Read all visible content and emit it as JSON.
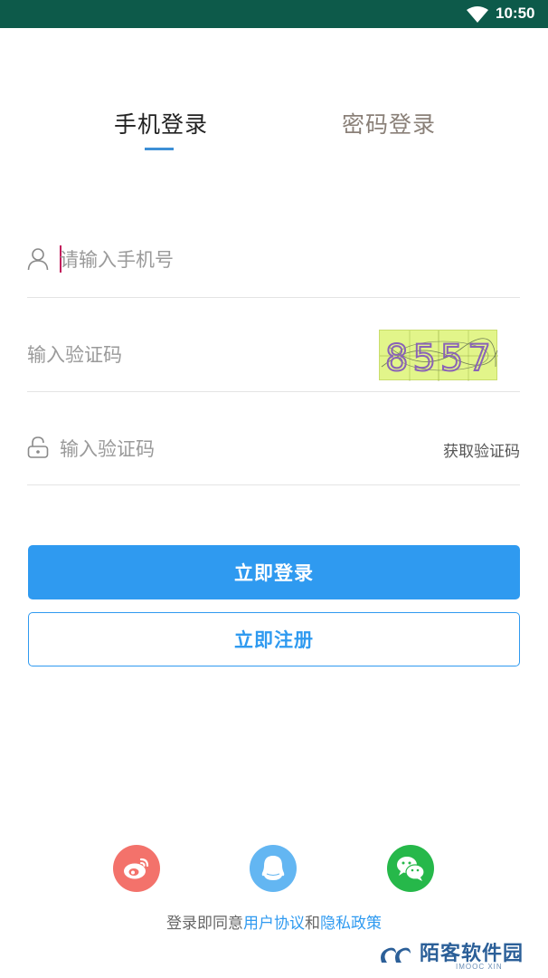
{
  "status_bar": {
    "time": "10:50",
    "wifi_icon": "wifi-icon"
  },
  "tabs": {
    "phone_login": "手机登录",
    "password_login": "密码登录",
    "active": "phone_login"
  },
  "form": {
    "phone_placeholder": "请输入手机号",
    "captcha_placeholder": "输入验证码",
    "captcha_image_text": "8557",
    "code_placeholder": "输入验证码",
    "get_code_label": "获取验证码"
  },
  "buttons": {
    "login": "立即登录",
    "register": "立即注册"
  },
  "social": [
    "weibo-icon",
    "qq-icon",
    "wechat-icon"
  ],
  "agreement": {
    "prefix": "登录即同意",
    "user_agreement": "用户协议",
    "and": "和",
    "privacy_policy": "隐私政策"
  },
  "watermark": {
    "text": "陌客软件园",
    "sub": "IMOOC XIN"
  },
  "colors": {
    "status_bar": "#0d5a4a",
    "accent": "#2f9af0",
    "weibo": "#f3726b",
    "qq": "#63b6f2",
    "wechat": "#26b84a"
  }
}
